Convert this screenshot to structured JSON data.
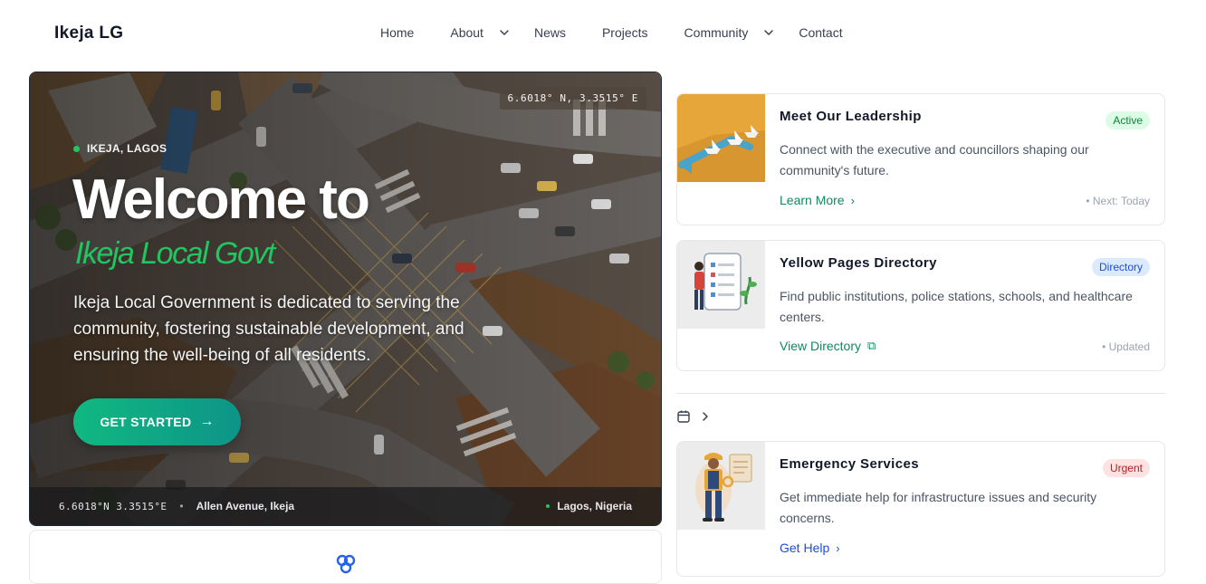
{
  "header": {
    "logo": "Ikeja LG",
    "nav": [
      {
        "label": "Home"
      },
      {
        "label": "About"
      },
      {
        "label": "News"
      },
      {
        "label": "Projects"
      },
      {
        "label": "Community"
      },
      {
        "label": "Contact"
      }
    ]
  },
  "hero": {
    "coord_badge": "6.6018° N, 3.3515° E",
    "location_tag": "IKEJA, LAGOS",
    "title": "Welcome to",
    "subtitle": "Ikeja Local Govt",
    "description": "Ikeja Local Government is dedicated to serving the community, fostering sustainable development, and ensuring the well-being of all residents.",
    "cta_label": "GET STARTED",
    "cta_arrow": "→",
    "footer": {
      "coords": "6.6018°N 3.3515°E",
      "separator": "•",
      "address": "Allen Avenue, Ikeja",
      "region": "Lagos, Nigeria"
    }
  },
  "cards": [
    {
      "title": "Meet Our Leadership",
      "badge": "Active",
      "badge_color": "#15803d",
      "badge_bg": "#dcfce7",
      "description": "Connect with the executive and councillors shaping our community's future.",
      "link": "Learn More",
      "link_icon": "›",
      "link_color": "#0f8a5f",
      "meta": "• Next: Today",
      "icon": "paper-boats-illustration"
    },
    {
      "title": "Yellow Pages Directory",
      "badge": "Directory",
      "badge_color": "#1d4ed8",
      "badge_bg": "#dbeafe",
      "description": "Find public institutions, police stations, schools, and healthcare centers.",
      "link": "View Directory",
      "link_icon": "⧉",
      "link_color": "#0f8a5f",
      "meta": "• Updated",
      "icon": "checklist-illustration"
    },
    {
      "title": "Emergency Services",
      "badge": "Urgent",
      "badge_color": "#b91c1c",
      "badge_bg": "#fee2e2",
      "description": "Get immediate help for infrastructure issues and security concerns.",
      "link": "Get Help",
      "link_icon": "›",
      "link_color": "#1d4ed8",
      "meta": "",
      "icon": "worker-illustration"
    }
  ],
  "small_row": {
    "icon": "calendar-icon",
    "chevron": "chevron-right-icon"
  }
}
